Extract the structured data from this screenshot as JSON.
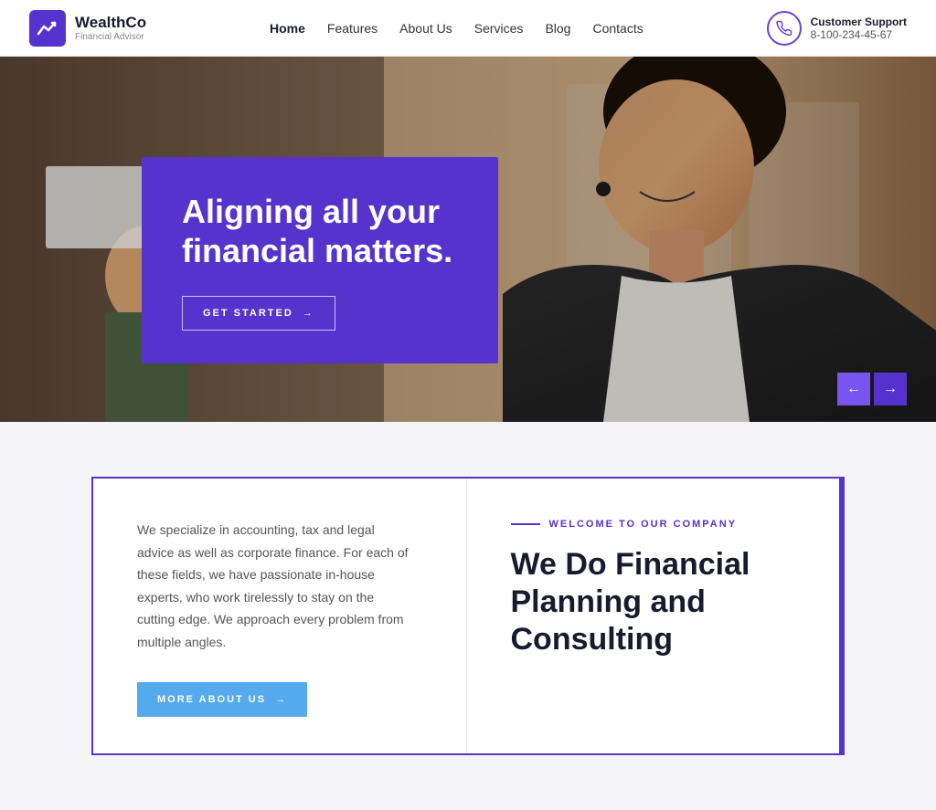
{
  "header": {
    "logo_name": "WealthCo",
    "logo_sub": "Financial Advisor",
    "nav": {
      "home": "Home",
      "features": "Features",
      "about_us": "About Us",
      "services": "Services",
      "blog": "Blog",
      "contacts": "Contacts"
    },
    "support_label": "Customer Support",
    "support_phone": "8-100-234-45-67"
  },
  "hero": {
    "title": "Aligning all your financial matters.",
    "btn_label": "GET STARTED",
    "arrow_prev": "←",
    "arrow_next": "→"
  },
  "section": {
    "desc": "We specialize in accounting, tax and legal advice as well as corporate finance. For each of these fields, we have passionate in-house experts, who work tirelessly to stay on the cutting edge. We approach every problem from multiple angles.",
    "more_btn": "MORE ABOUT US",
    "welcome_label": "WELCOME TO OUR COMPANY",
    "title_line1": "We Do Financial",
    "title_line2": "Planning and",
    "title_line3": "Consulting"
  },
  "colors": {
    "purple": "#5533cc",
    "light_blue": "#55aaee"
  },
  "icons": {
    "logo": "chart-line",
    "support": "phone",
    "arrow_right": "→",
    "arrow_left": "←"
  }
}
